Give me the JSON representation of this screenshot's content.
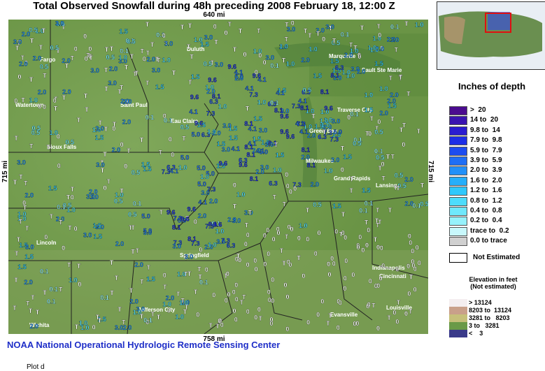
{
  "title": "Total Observed Snowfall during 48h preceding 2008 February 18, 12:00 Z",
  "scale": {
    "top": "640 mi",
    "bottom": "758 mi",
    "left": "715 mi",
    "right": "715 mi"
  },
  "footer": "NOAA National Operational Hydrologic Remote Sensing Center",
  "footer_partial": "Plot d",
  "legend": {
    "title": "Inches of depth",
    "not_estimated": "Not Estimated",
    "classes": [
      {
        "label": ">  20",
        "color": "#4b0c8f"
      },
      {
        "label": "14 to  20",
        "color": "#3a14b0"
      },
      {
        "label": "9.8 to  14",
        "color": "#2a1cd0"
      },
      {
        "label": "7.9 to  9.8",
        "color": "#1c2ee6"
      },
      {
        "label": "5.9 to  7.9",
        "color": "#1d4cf0"
      },
      {
        "label": "3.9 to  5.9",
        "color": "#1f6ef5"
      },
      {
        "label": "2.0 to  3.9",
        "color": "#2290f8"
      },
      {
        "label": "1.6 to  2.0",
        "color": "#26aefa"
      },
      {
        "label": "1.2 to  1.6",
        "color": "#2fc8fc"
      },
      {
        "label": "0.8 to  1.2",
        "color": "#4ddcfc"
      },
      {
        "label": "0.4 to  0.8",
        "color": "#6fe8fc"
      },
      {
        "label": "0.2 to  0.4",
        "color": "#96f2fc"
      },
      {
        "label": "trace to  0.2",
        "color": "#c8f8fc"
      },
      {
        "label": "0.0 to trace",
        "color": "#d0d0d0"
      }
    ],
    "elevation_title": "Elevation in feet\n(Not estimated)",
    "elevation": [
      {
        "label": "> 13124",
        "color": "#f4eef0"
      },
      {
        "label": "8203 to  13124",
        "color": "#c9a08a"
      },
      {
        "label": "3281 to   8203",
        "color": "#c6c07a"
      },
      {
        "label": "3 to   3281",
        "color": "#6a9a48"
      },
      {
        "label": "<    3",
        "color": "#3a3a8a"
      }
    ]
  },
  "cities": [
    "Duluth",
    "Marquette",
    "Sault Ste Marie",
    "Fargo",
    "Saint Paul",
    "Eau Claire",
    "Traverse City",
    "Green Bay",
    "Milwaukee",
    "Grand Rapids",
    "Lansing",
    "Watertown",
    "Sioux Falls",
    "Lincoln",
    "Springfield",
    "Evansville",
    "Cincinnati",
    "Indianapolis",
    "Wichita",
    "Jefferson City",
    "Louisville"
  ],
  "sample_observations": [
    "T",
    "0",
    "0.1",
    "0.5",
    "1.0",
    "1.5",
    "2.0",
    "3.0",
    "4.1",
    "5.0",
    "6.3",
    "7.3",
    "8.1",
    "9.6"
  ]
}
